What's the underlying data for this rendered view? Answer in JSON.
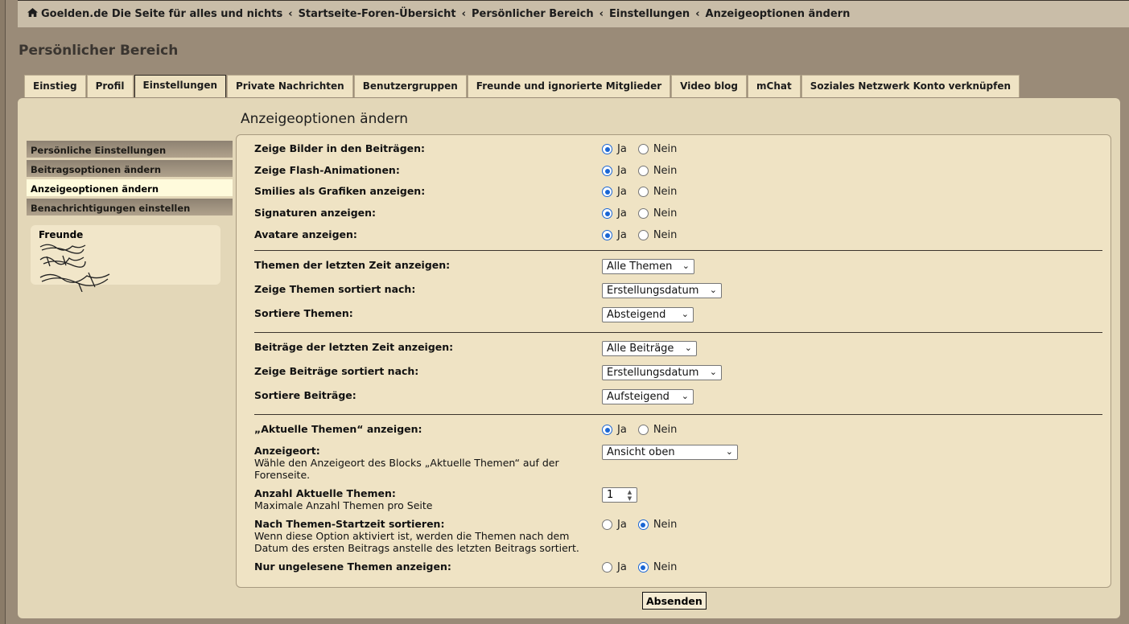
{
  "breadcrumbs": [
    {
      "label": "Goelden.de Die Seite für alles und nichts"
    },
    {
      "label": "Startseite-Foren-Übersicht"
    },
    {
      "label": "Persönlicher Bereich"
    },
    {
      "label": "Einstellungen"
    },
    {
      "label": "Anzeigeoptionen ändern"
    }
  ],
  "page_title": "Persönlicher Bereich",
  "tabs": [
    {
      "label": "Einstieg"
    },
    {
      "label": "Profil"
    },
    {
      "label": "Einstellungen",
      "active": true
    },
    {
      "label": "Private Nachrichten"
    },
    {
      "label": "Benutzergruppen"
    },
    {
      "label": "Freunde und ignorierte Mitglieder"
    },
    {
      "label": "Video blog"
    },
    {
      "label": "mChat"
    },
    {
      "label": "Soziales Netzwerk Konto verknüpfen"
    }
  ],
  "sidebar": {
    "items": [
      {
        "label": "Persönliche Einstellungen"
      },
      {
        "label": "Beitragsoptionen ändern"
      },
      {
        "label": "Anzeigeoptionen ändern",
        "active": true
      },
      {
        "label": "Benachrichtigungen einstellen"
      }
    ],
    "friends_title": "Freunde"
  },
  "content_title": "Anzeigeoptionen ändern",
  "radio_labels": {
    "yes": "Ja",
    "no": "Nein"
  },
  "options": {
    "images": {
      "label": "Zeige Bilder in den Beiträgen:",
      "value": "Ja"
    },
    "flash": {
      "label": "Zeige Flash-Animationen:",
      "value": "Ja"
    },
    "smilies": {
      "label": "Smilies als Grafiken anzeigen:",
      "value": "Ja"
    },
    "signatures": {
      "label": "Signaturen anzeigen:",
      "value": "Ja"
    },
    "avatars": {
      "label": "Avatare anzeigen:",
      "value": "Ja"
    },
    "topic_days": {
      "label": "Themen der letzten Zeit anzeigen:",
      "value": "Alle Themen"
    },
    "topic_sort": {
      "label": "Zeige Themen sortiert nach:",
      "value": "Erstellungsdatum"
    },
    "topic_order": {
      "label": "Sortiere Themen:",
      "value": "Absteigend"
    },
    "post_days": {
      "label": "Beiträge der letzten Zeit anzeigen:",
      "value": "Alle Beiträge"
    },
    "post_sort": {
      "label": "Zeige Beiträge sortiert nach:",
      "value": "Erstellungsdatum"
    },
    "post_order": {
      "label": "Sortiere Beiträge:",
      "value": "Aufsteigend"
    },
    "recent_topics": {
      "label": "„Aktuelle Themen“ anzeigen:",
      "value": "Ja"
    },
    "location": {
      "label": "Anzeigeort:",
      "desc1": "Wähle den Anzeigeort des Blocks „Aktuelle Themen“ auf der",
      "desc2": "Forenseite.",
      "value": "Ansicht oben"
    },
    "count": {
      "label": "Anzahl Aktuelle Themen:",
      "desc1": "Maximale Anzahl Themen pro Seite",
      "value": "1"
    },
    "start_sort": {
      "label": "Nach Themen-Startzeit sortieren:",
      "desc1": "Wenn diese Option aktiviert ist, werden die Themen nach dem",
      "desc2": "Datum des ersten Beitrags anstelle des letzten Beitrags sortiert.",
      "value": "Nein"
    },
    "unread_only": {
      "label": "Nur ungelesene Themen anzeigen:",
      "value": "Nein"
    }
  },
  "submit_label": "Absenden"
}
